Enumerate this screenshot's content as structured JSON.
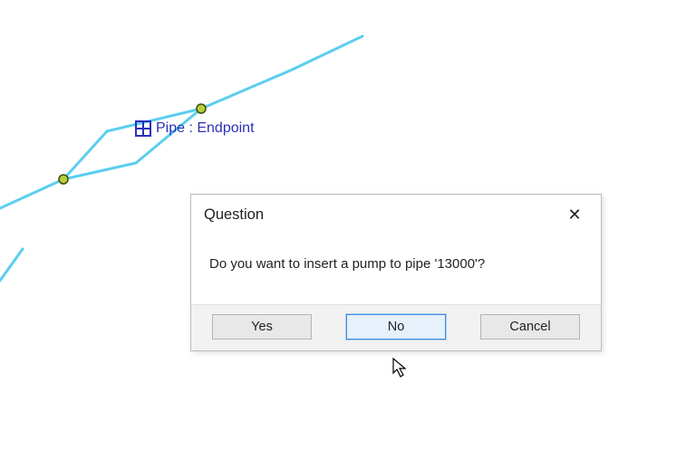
{
  "canvas": {
    "snap_label": "Pipe : Endpoint",
    "pipe_color": "#5bcef0",
    "node_fill": "#b7cf3c",
    "node_stroke": "#3d4d00"
  },
  "dialog": {
    "title": "Question",
    "message": "Do you want to insert a pump to pipe '13000'?",
    "buttons": {
      "yes": "Yes",
      "no": "No",
      "cancel": "Cancel"
    }
  }
}
